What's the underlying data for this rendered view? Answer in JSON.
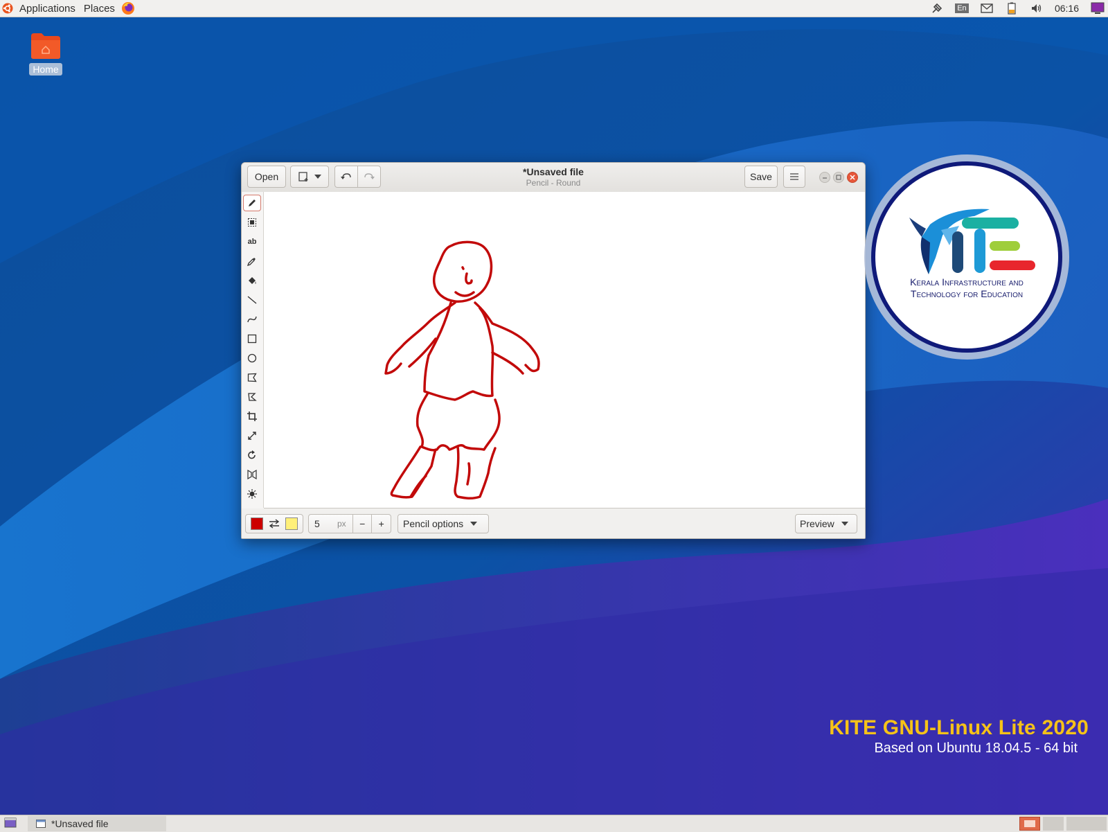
{
  "top_panel": {
    "applications_label": "Applications",
    "places_label": "Places",
    "tray": {
      "keyboard_layout": "En",
      "clock": "06:16"
    },
    "icons": [
      "ubuntu-logo-icon",
      "firefox-icon",
      "network-icon",
      "mail-icon",
      "battery-icon",
      "volume-icon",
      "session-icon"
    ]
  },
  "desktop": {
    "home_icon_label": "Home",
    "logo_text_line1": "Kerala Infrastructure and",
    "logo_text_line2": "Technology for Education",
    "brand_title": "KITE GNU-Linux Lite 2020",
    "brand_subtitle": "Based on Ubuntu 18.04.5 - 64 bit"
  },
  "window": {
    "title": "*Unsaved file",
    "subtitle": "Pencil - Round",
    "open_label": "Open",
    "save_label": "Save",
    "tools": [
      "pencil-icon",
      "selection-icon",
      "text-icon",
      "color-picker-icon",
      "paint-bucket-icon",
      "line-icon",
      "curve-icon",
      "rectangle-icon",
      "circle-icon",
      "polygon-icon",
      "freeshape-icon",
      "crop-icon",
      "scale-icon",
      "rotate-icon",
      "skew-icon",
      "filters-icon"
    ],
    "bottom": {
      "main_color": "#cc0000",
      "secondary_color": "#fff07a",
      "size_value": "5",
      "size_unit": "px",
      "minus_label": "−",
      "plus_label": "+",
      "options_label": "Pencil options",
      "preview_label": "Preview"
    }
  },
  "taskbar": {
    "task_title": "*Unsaved file"
  }
}
